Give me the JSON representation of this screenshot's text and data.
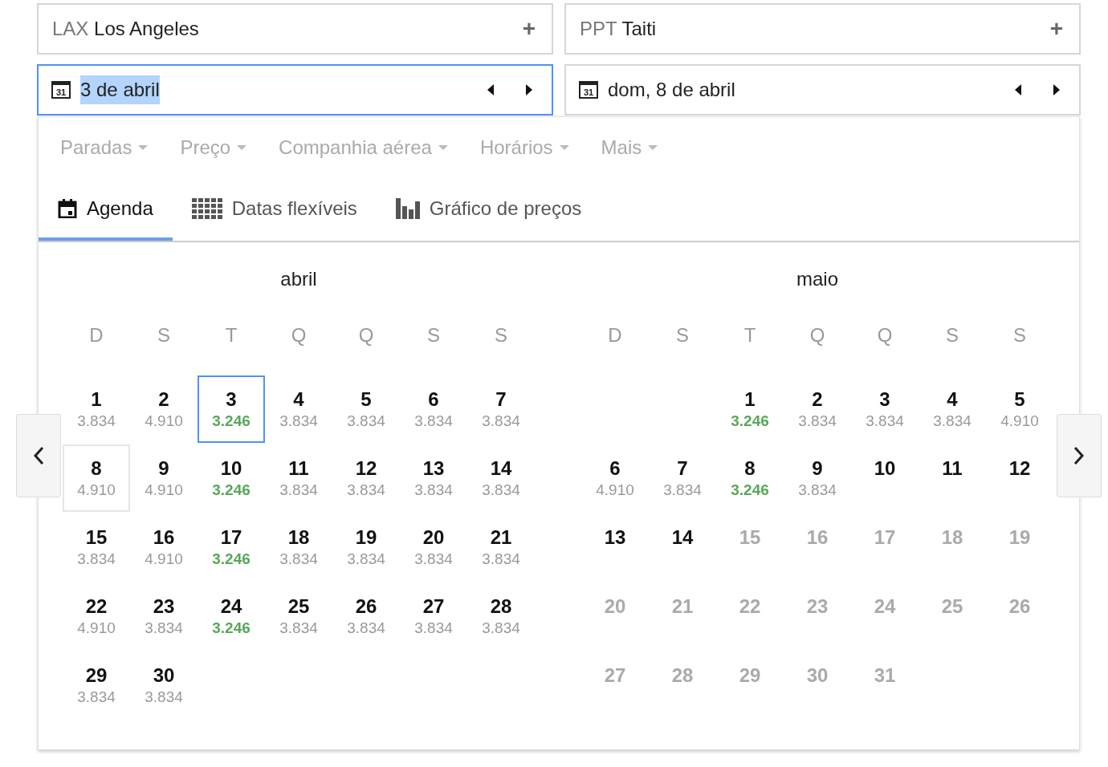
{
  "route": [
    {
      "code": "LAX",
      "city": "Los Angeles",
      "action": "+"
    },
    {
      "code": "PPT",
      "city": "Taiti",
      "action": "+"
    }
  ],
  "dates": [
    {
      "icon_label": "31",
      "value": "3 de abril",
      "focused": true,
      "text_selected": true
    },
    {
      "icon_label": "31",
      "value": "dom, 8 de abril",
      "focused": false,
      "text_selected": false
    }
  ],
  "filters": [
    "Paradas",
    "Preço",
    "Companhia aérea",
    "Horários",
    "Mais"
  ],
  "tabs": [
    {
      "label": "Agenda",
      "kind": "calendar",
      "selected": true
    },
    {
      "label": "Datas flexíveis",
      "kind": "grid",
      "selected": false
    },
    {
      "label": "Gráfico de preços",
      "kind": "chart",
      "selected": false
    }
  ],
  "months": [
    {
      "name": "abril",
      "weekdays": [
        "D",
        "S",
        "T",
        "Q",
        "Q",
        "S",
        "S"
      ],
      "days": [
        {
          "day": "1",
          "price": "3.834",
          "selected": false,
          "return_date": false,
          "cheapest": false,
          "disabled": false
        },
        {
          "day": "2",
          "price": "4.910",
          "selected": false,
          "return_date": false,
          "cheapest": false,
          "disabled": false
        },
        {
          "day": "3",
          "price": "3.246",
          "selected": true,
          "return_date": false,
          "cheapest": true,
          "disabled": false
        },
        {
          "day": "4",
          "price": "3.834",
          "selected": false,
          "return_date": false,
          "cheapest": false,
          "disabled": false
        },
        {
          "day": "5",
          "price": "3.834",
          "selected": false,
          "return_date": false,
          "cheapest": false,
          "disabled": false
        },
        {
          "day": "6",
          "price": "3.834",
          "selected": false,
          "return_date": false,
          "cheapest": false,
          "disabled": false
        },
        {
          "day": "7",
          "price": "3.834",
          "selected": false,
          "return_date": false,
          "cheapest": false,
          "disabled": false
        },
        {
          "day": "8",
          "price": "4.910",
          "selected": false,
          "return_date": true,
          "cheapest": false,
          "disabled": false
        },
        {
          "day": "9",
          "price": "4.910",
          "selected": false,
          "return_date": false,
          "cheapest": false,
          "disabled": false
        },
        {
          "day": "10",
          "price": "3.246",
          "selected": false,
          "return_date": false,
          "cheapest": true,
          "disabled": false
        },
        {
          "day": "11",
          "price": "3.834",
          "selected": false,
          "return_date": false,
          "cheapest": false,
          "disabled": false
        },
        {
          "day": "12",
          "price": "3.834",
          "selected": false,
          "return_date": false,
          "cheapest": false,
          "disabled": false
        },
        {
          "day": "13",
          "price": "3.834",
          "selected": false,
          "return_date": false,
          "cheapest": false,
          "disabled": false
        },
        {
          "day": "14",
          "price": "3.834",
          "selected": false,
          "return_date": false,
          "cheapest": false,
          "disabled": false
        },
        {
          "day": "15",
          "price": "3.834",
          "selected": false,
          "return_date": false,
          "cheapest": false,
          "disabled": false
        },
        {
          "day": "16",
          "price": "4.910",
          "selected": false,
          "return_date": false,
          "cheapest": false,
          "disabled": false
        },
        {
          "day": "17",
          "price": "3.246",
          "selected": false,
          "return_date": false,
          "cheapest": true,
          "disabled": false
        },
        {
          "day": "18",
          "price": "3.834",
          "selected": false,
          "return_date": false,
          "cheapest": false,
          "disabled": false
        },
        {
          "day": "19",
          "price": "3.834",
          "selected": false,
          "return_date": false,
          "cheapest": false,
          "disabled": false
        },
        {
          "day": "20",
          "price": "3.834",
          "selected": false,
          "return_date": false,
          "cheapest": false,
          "disabled": false
        },
        {
          "day": "21",
          "price": "3.834",
          "selected": false,
          "return_date": false,
          "cheapest": false,
          "disabled": false
        },
        {
          "day": "22",
          "price": "4.910",
          "selected": false,
          "return_date": false,
          "cheapest": false,
          "disabled": false
        },
        {
          "day": "23",
          "price": "3.834",
          "selected": false,
          "return_date": false,
          "cheapest": false,
          "disabled": false
        },
        {
          "day": "24",
          "price": "3.246",
          "selected": false,
          "return_date": false,
          "cheapest": true,
          "disabled": false
        },
        {
          "day": "25",
          "price": "3.834",
          "selected": false,
          "return_date": false,
          "cheapest": false,
          "disabled": false
        },
        {
          "day": "26",
          "price": "3.834",
          "selected": false,
          "return_date": false,
          "cheapest": false,
          "disabled": false
        },
        {
          "day": "27",
          "price": "3.834",
          "selected": false,
          "return_date": false,
          "cheapest": false,
          "disabled": false
        },
        {
          "day": "28",
          "price": "3.834",
          "selected": false,
          "return_date": false,
          "cheapest": false,
          "disabled": false
        },
        {
          "day": "29",
          "price": "3.834",
          "selected": false,
          "return_date": false,
          "cheapest": false,
          "disabled": false
        },
        {
          "day": "30",
          "price": "3.834",
          "selected": false,
          "return_date": false,
          "cheapest": false,
          "disabled": false
        }
      ]
    },
    {
      "name": "maio",
      "weekdays": [
        "D",
        "S",
        "T",
        "Q",
        "Q",
        "S",
        "S"
      ],
      "days": [
        {
          "kind": "blank"
        },
        {
          "kind": "blank"
        },
        {
          "day": "1",
          "price": "3.246",
          "selected": false,
          "return_date": false,
          "cheapest": true,
          "disabled": false
        },
        {
          "day": "2",
          "price": "3.834",
          "selected": false,
          "return_date": false,
          "cheapest": false,
          "disabled": false
        },
        {
          "day": "3",
          "price": "3.834",
          "selected": false,
          "return_date": false,
          "cheapest": false,
          "disabled": false
        },
        {
          "day": "4",
          "price": "3.834",
          "selected": false,
          "return_date": false,
          "cheapest": false,
          "disabled": false
        },
        {
          "day": "5",
          "price": "4.910",
          "selected": false,
          "return_date": false,
          "cheapest": false,
          "disabled": false
        },
        {
          "day": "6",
          "price": "4.910",
          "selected": false,
          "return_date": false,
          "cheapest": false,
          "disabled": false
        },
        {
          "day": "7",
          "price": "3.834",
          "selected": false,
          "return_date": false,
          "cheapest": false,
          "disabled": false
        },
        {
          "day": "8",
          "price": "3.246",
          "selected": false,
          "return_date": false,
          "cheapest": true,
          "disabled": false
        },
        {
          "day": "9",
          "price": "3.834",
          "selected": false,
          "return_date": false,
          "cheapest": false,
          "disabled": false
        },
        {
          "day": "10",
          "selected": false,
          "return_date": false,
          "cheapest": false,
          "disabled": false
        },
        {
          "day": "11",
          "selected": false,
          "return_date": false,
          "cheapest": false,
          "disabled": false
        },
        {
          "day": "12",
          "selected": false,
          "return_date": false,
          "cheapest": false,
          "disabled": false
        },
        {
          "day": "13",
          "selected": false,
          "return_date": false,
          "cheapest": false,
          "disabled": false
        },
        {
          "day": "14",
          "selected": false,
          "return_date": false,
          "cheapest": false,
          "disabled": false
        },
        {
          "day": "15",
          "selected": false,
          "return_date": false,
          "cheapest": false,
          "disabled": true
        },
        {
          "day": "16",
          "selected": false,
          "return_date": false,
          "cheapest": false,
          "disabled": true
        },
        {
          "day": "17",
          "selected": false,
          "return_date": false,
          "cheapest": false,
          "disabled": true
        },
        {
          "day": "18",
          "selected": false,
          "return_date": false,
          "cheapest": false,
          "disabled": true
        },
        {
          "day": "19",
          "selected": false,
          "return_date": false,
          "cheapest": false,
          "disabled": true
        },
        {
          "day": "20",
          "selected": false,
          "return_date": false,
          "cheapest": false,
          "disabled": true
        },
        {
          "day": "21",
          "selected": false,
          "return_date": false,
          "cheapest": false,
          "disabled": true
        },
        {
          "day": "22",
          "selected": false,
          "return_date": false,
          "cheapest": false,
          "disabled": true
        },
        {
          "day": "23",
          "selected": false,
          "return_date": false,
          "cheapest": false,
          "disabled": true
        },
        {
          "day": "24",
          "selected": false,
          "return_date": false,
          "cheapest": false,
          "disabled": true
        },
        {
          "day": "25",
          "selected": false,
          "return_date": false,
          "cheapest": false,
          "disabled": true
        },
        {
          "day": "26",
          "selected": false,
          "return_date": false,
          "cheapest": false,
          "disabled": true
        },
        {
          "day": "27",
          "selected": false,
          "return_date": false,
          "cheapest": false,
          "disabled": true
        },
        {
          "day": "28",
          "selected": false,
          "return_date": false,
          "cheapest": false,
          "disabled": true
        },
        {
          "day": "29",
          "selected": false,
          "return_date": false,
          "cheapest": false,
          "disabled": true
        },
        {
          "day": "30",
          "selected": false,
          "return_date": false,
          "cheapest": false,
          "disabled": true
        },
        {
          "day": "31",
          "selected": false,
          "return_date": false,
          "cheapest": false,
          "disabled": true
        }
      ]
    }
  ]
}
